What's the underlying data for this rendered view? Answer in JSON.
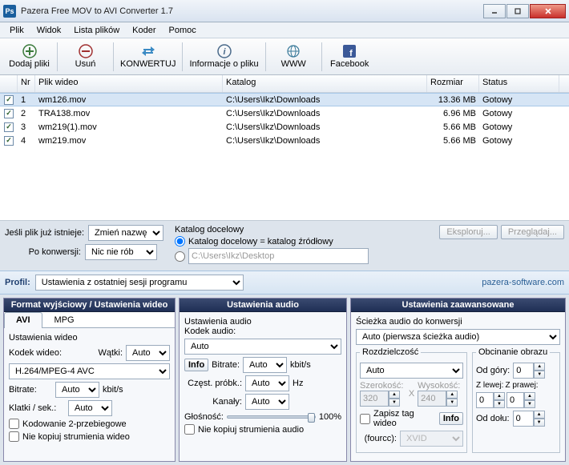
{
  "window": {
    "title": "Pazera Free MOV to AVI Converter 1.7"
  },
  "menu": {
    "items": [
      "Plik",
      "Widok",
      "Lista plików",
      "Koder",
      "Pomoc"
    ]
  },
  "toolbar": {
    "add": "Dodaj pliki",
    "remove": "Usuń",
    "convert": "KONWERTUJ",
    "info": "Informacje o pliku",
    "www": "WWW",
    "facebook": "Facebook"
  },
  "list": {
    "headers": [
      "",
      "Nr",
      "Plik wideo",
      "Katalog",
      "Rozmiar",
      "Status"
    ],
    "rows": [
      {
        "chk": true,
        "nr": "1",
        "file": "wm126.mov",
        "dir": "C:\\Users\\Ikz\\Downloads",
        "size": "13.36 MB",
        "status": "Gotowy",
        "selected": true
      },
      {
        "chk": true,
        "nr": "2",
        "file": "TRA138.mov",
        "dir": "C:\\Users\\Ikz\\Downloads",
        "size": "6.96 MB",
        "status": "Gotowy",
        "selected": false
      },
      {
        "chk": true,
        "nr": "3",
        "file": "wm219(1).mov",
        "dir": "C:\\Users\\Ikz\\Downloads",
        "size": "5.66 MB",
        "status": "Gotowy",
        "selected": false
      },
      {
        "chk": true,
        "nr": "4",
        "file": "wm219.mov",
        "dir": "C:\\Users\\Ikz\\Downloads",
        "size": "5.66 MB",
        "status": "Gotowy",
        "selected": false
      }
    ]
  },
  "opts": {
    "exists_label": "Jeśli plik już istnieje:",
    "exists_value": "Zmień nazwę",
    "after_label": "Po konwersji:",
    "after_value": "Nic nie rób",
    "outdir_title": "Katalog docelowy",
    "outdir_same": "Katalog docelowy = katalog źródłowy",
    "outdir_custom_path": "C:\\Users\\Ikz\\Desktop",
    "explore": "Eksploruj...",
    "browse": "Przeglądaj..."
  },
  "profile": {
    "label": "Profil:",
    "value": "Ustawienia z ostatniej sesji programu",
    "link": "pazera-software.com"
  },
  "video_panel": {
    "title": "Format wyjściowy / Ustawienia wideo",
    "tab_avi": "AVI",
    "tab_mpg": "MPG",
    "settings_label": "Ustawienia wideo",
    "codec_label": "Kodek wideo:",
    "codec_value": "H.264/MPEG-4 AVC",
    "threads_label": "Wątki:",
    "threads_value": "Auto",
    "bitrate_label": "Bitrate:",
    "bitrate_value": "Auto",
    "bitrate_unit": "kbit/s",
    "fps_label": "Klatki / sek.:",
    "fps_value": "Auto",
    "twopass": "Kodowanie 2-przebiegowe",
    "nocopy": "Nie kopiuj strumienia wideo"
  },
  "audio_panel": {
    "title": "Ustawienia audio",
    "settings_label": "Ustawienia audio",
    "codec_label": "Kodek audio:",
    "codec_value": "Auto",
    "info": "Info",
    "bitrate_label": "Bitrate:",
    "bitrate_value": "Auto",
    "bitrate_unit": "kbit/s",
    "sample_label": "Częst. próbk.:",
    "sample_value": "Auto",
    "sample_unit": "Hz",
    "channels_label": "Kanały:",
    "channels_value": "Auto",
    "volume_label": "Głośność:",
    "volume_value": "100%",
    "nocopy": "Nie kopiuj strumienia audio"
  },
  "adv_panel": {
    "title": "Ustawienia zaawansowane",
    "track_label": "Ścieżka audio do konwersji",
    "track_value": "Auto (pierwsza ścieżka audio)",
    "res_legend": "Rozdzielczość",
    "res_value": "Auto",
    "width_label": "Szerokość:",
    "width_value": "320",
    "height_label": "Wysokość:",
    "height_value": "240",
    "crop_legend": "Obcinanie obrazu",
    "top_label": "Od góry:",
    "left_label": "Z lewej:",
    "right_label": "Z prawej:",
    "bottom_label": "Od dołu:",
    "zero": "0",
    "tag_label": "Zapisz tag wideo",
    "info": "Info",
    "fourcc_label": "(fourcc):",
    "fourcc_value": "XVID"
  }
}
